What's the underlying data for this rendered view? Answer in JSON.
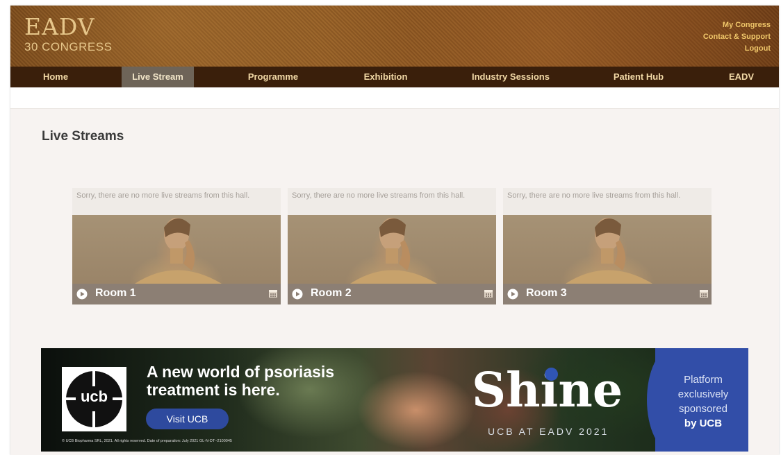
{
  "header": {
    "logo": {
      "brand": "EADV",
      "sub": "30 CONGRESS"
    },
    "links": [
      "My Congress",
      "Contact & Support",
      "Logout"
    ]
  },
  "nav": {
    "items": [
      "Home",
      "Live Stream",
      "Programme",
      "Exhibition",
      "Industry Sessions",
      "Patient Hub",
      "EADV"
    ],
    "active": "Live Stream"
  },
  "page": {
    "title": "Live Streams"
  },
  "cards": [
    {
      "message": "Sorry, there are no more live streams from this hall.",
      "room": "Room 1"
    },
    {
      "message": "Sorry, there are no more live streams from this hall.",
      "room": "Room 2"
    },
    {
      "message": "Sorry, there are no more live streams from this hall.",
      "room": "Room 3"
    }
  ],
  "banner": {
    "logo_text": "ucb",
    "headline_1": "A new world of psoriasis",
    "headline_2": "treatment is here.",
    "button": "Visit UCB",
    "legal": "© UCB Biopharma SRL, 2021. All rights reserved. Date of preparation: July 2021 GL-N-DT--2100045",
    "shine": "Shine",
    "subline": "UCB AT EADV 2021",
    "sponsor_1": "Platform",
    "sponsor_2": "exclusively",
    "sponsor_3": "sponsored",
    "sponsor_4": "by UCB"
  },
  "colors": {
    "nav_bg": "#3a1f0b",
    "nav_text": "#f2d9a6",
    "active_tab": "#6e6458",
    "link_gold": "#f0c76a",
    "card_bar": "#8c7f74",
    "banner_blue": "#324ea8"
  },
  "icons": [
    "play-icon",
    "calendar-icon"
  ]
}
